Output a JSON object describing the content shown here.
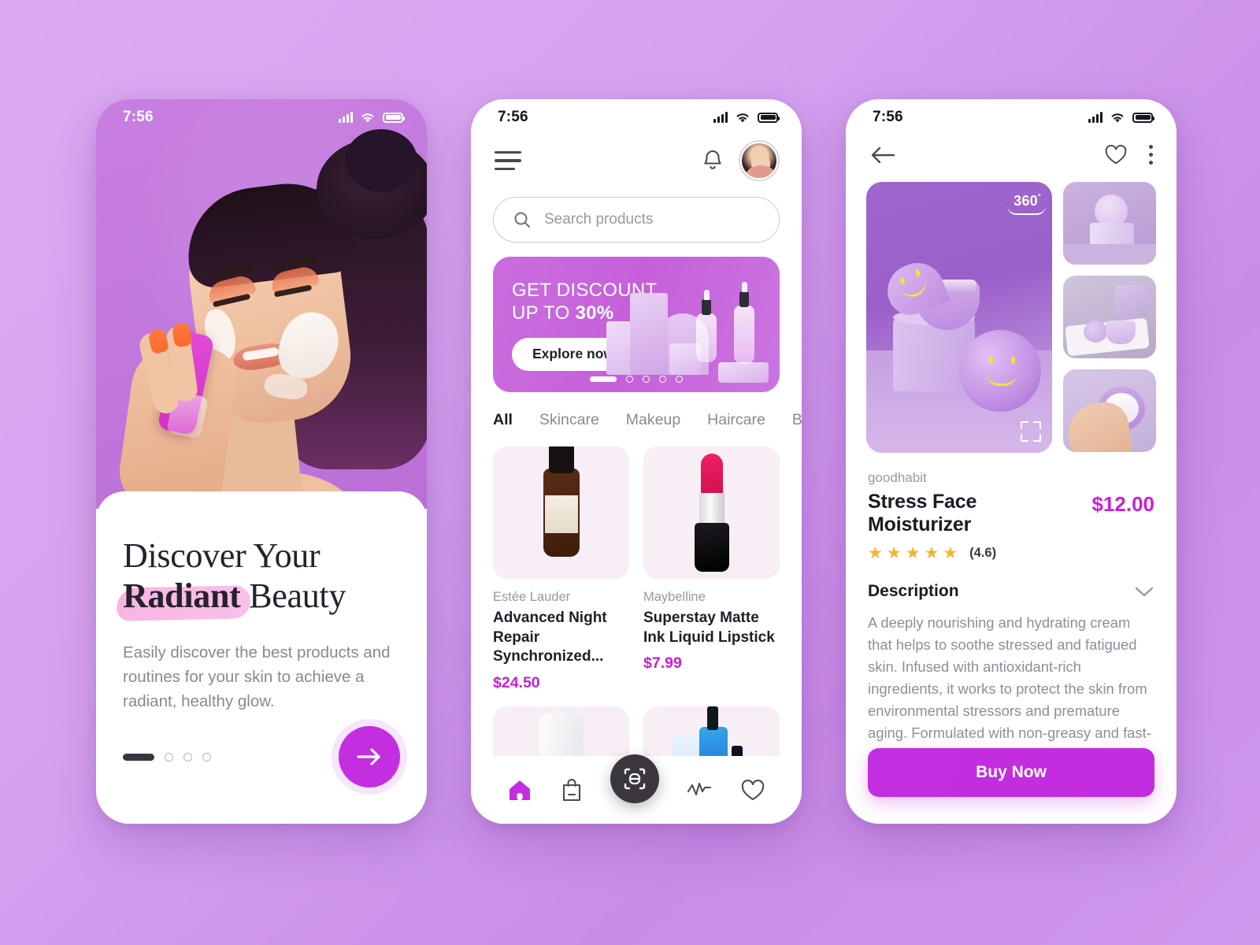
{
  "meta": {
    "status_time": "7:56"
  },
  "screen_onboarding": {
    "headline_line1": "Discover Your",
    "headline_highlight": "Radiant",
    "headline_tail": " Beauty",
    "subcopy": "Easily discover the best products and routines for your skin to achieve a radiant, healthy glow.",
    "next_icon": "arrow-right-icon",
    "pagination": {
      "active": 1,
      "total": 4
    }
  },
  "screen_home": {
    "menu_icon": "hamburger-menu-icon",
    "bell_icon": "notification-bell-icon",
    "avatar_icon": "user-avatar",
    "search": {
      "placeholder": "Search products",
      "icon": "search-icon"
    },
    "banner": {
      "line1": "GET DISCOUNT",
      "line2_prefix": "UP TO ",
      "line2_value": "30%",
      "cta": "Explore now",
      "dots_total": 5,
      "dots_active": 1
    },
    "tabs": [
      {
        "label": "All",
        "active": true
      },
      {
        "label": "Skincare",
        "active": false
      },
      {
        "label": "Makeup",
        "active": false
      },
      {
        "label": "Haircare",
        "active": false
      },
      {
        "label": "Body",
        "active": false
      }
    ],
    "products": [
      {
        "brand": "Estée Lauder",
        "name": "Advanced Night Repair Synchronized...",
        "price": "$24.50",
        "art": "serum-bottle"
      },
      {
        "brand": "Maybelline",
        "name": "Superstay Matte Ink Liquid Lipstick",
        "price": "$7.99",
        "art": "lipstick"
      },
      {
        "brand": "",
        "name": "",
        "price": "",
        "art": "face-tube"
      },
      {
        "brand": "",
        "name": "",
        "price": "",
        "art": "blue-set"
      }
    ],
    "nav": [
      {
        "icon": "home-icon",
        "active": true
      },
      {
        "icon": "shopping-bag-icon",
        "active": false
      },
      {
        "icon": "scan-icon",
        "active": false
      },
      {
        "icon": "activity-pulse-icon",
        "active": false
      },
      {
        "icon": "heart-icon",
        "active": false
      }
    ]
  },
  "screen_product": {
    "back_icon": "back-arrow-icon",
    "favorite_icon": "heart-icon",
    "more_icon": "kebab-menu-icon",
    "badge_360": "360",
    "badge_360_sup": "°",
    "expand_icon": "fullscreen-expand-icon",
    "brand": "goodhabit",
    "title": "Stress Face Moisturizer",
    "price": "$12.00",
    "rating_value": "(4.6)",
    "stars_filled": 5,
    "section_title": "Description",
    "chevron_icon": "chevron-down-icon",
    "description": "A deeply nourishing and hydrating cream that helps to soothe stressed and fatigued skin. Infused with antioxidant-rich ingredients, it works to protect the skin from environmental stressors and premature aging. Formulated with non-greasy and fast-absorbing texture, it leaves the skin looking radiant, plump, and revitalized.",
    "buy_label": "Buy Now"
  },
  "colors": {
    "accent": "#c22ee0",
    "price": "#c71fd6",
    "star": "#f5b52c",
    "background": "#d6a3ef",
    "highlight": "#f7aee0"
  }
}
